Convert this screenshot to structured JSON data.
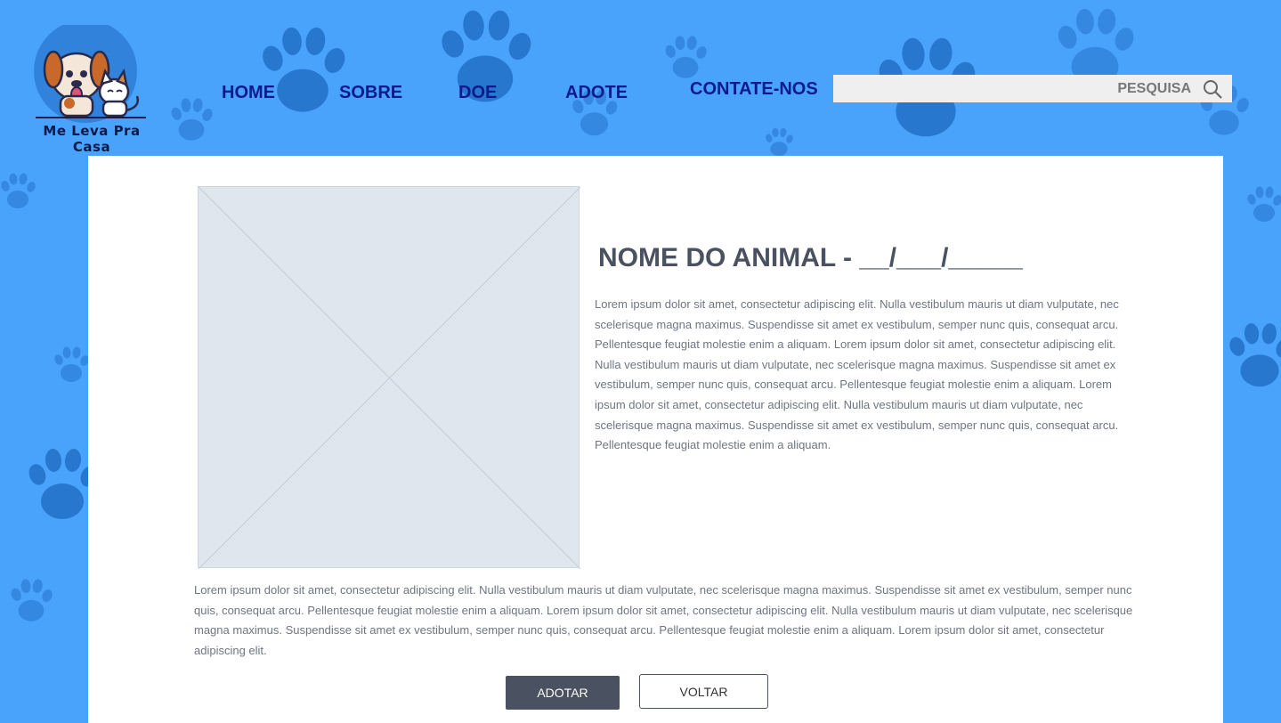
{
  "brand": {
    "name": "Me Leva Pra Casa",
    "logo_icon": "dog-and-cat-logo"
  },
  "nav": {
    "items": [
      {
        "label": "HOME"
      },
      {
        "label": "SOBRE"
      },
      {
        "label": "DOE"
      },
      {
        "label": "ADOTE"
      },
      {
        "label": "CONTATE-NOS"
      }
    ]
  },
  "search": {
    "placeholder": "PESQUISA",
    "value": "",
    "icon": "search-icon"
  },
  "animal": {
    "title": "NOME DO ANIMAL - __/___/_____",
    "image_icon": "image-placeholder",
    "description": "Lorem ipsum dolor sit amet, consectetur adipiscing elit. Nulla vestibulum mauris ut diam vulputate, nec scelerisque magna maximus. Suspendisse sit amet ex vestibulum, semper nunc quis, consequat arcu. Pellentesque feugiat molestie enim a aliquam. Lorem ipsum dolor sit amet, consectetur adipiscing elit. Nulla vestibulum mauris ut diam vulputate, nec scelerisque magna maximus. Suspendisse sit amet ex vestibulum, semper nunc quis, consequat arcu. Pellentesque feugiat molestie enim a aliquam. Lorem ipsum dolor sit amet, consectetur adipiscing elit. Nulla vestibulum mauris ut diam vulputate, nec scelerisque magna maximus. Suspendisse sit amet ex vestibulum, semper nunc quis, consequat arcu. Pellentesque feugiat molestie enim a aliquam.",
    "details": "Lorem ipsum dolor sit amet, consectetur adipiscing elit. Nulla vestibulum mauris ut diam vulputate, nec scelerisque magna maximus. Suspendisse sit amet ex vestibulum, semper nunc quis, consequat arcu. Pellentesque feugiat molestie enim a aliquam. Lorem ipsum dolor sit amet, consectetur adipiscing elit. Nulla vestibulum mauris ut diam vulputate, nec scelerisque magna maximus. Suspendisse sit amet ex vestibulum, semper nunc quis, consequat arcu. Pellentesque feugiat molestie enim a aliquam. Lorem ipsum dolor sit amet, consectetur adipiscing elit."
  },
  "actions": {
    "adopt_label": "ADOTAR",
    "back_label": "VOLTAR"
  },
  "colors": {
    "background": "#4aa3fb",
    "paw_prints": "#2e7fd6",
    "nav_text": "#0b1a8c",
    "primary_button": "#4a5160",
    "card": "#ffffff"
  },
  "background_pattern_icon": "paw-print-icon"
}
